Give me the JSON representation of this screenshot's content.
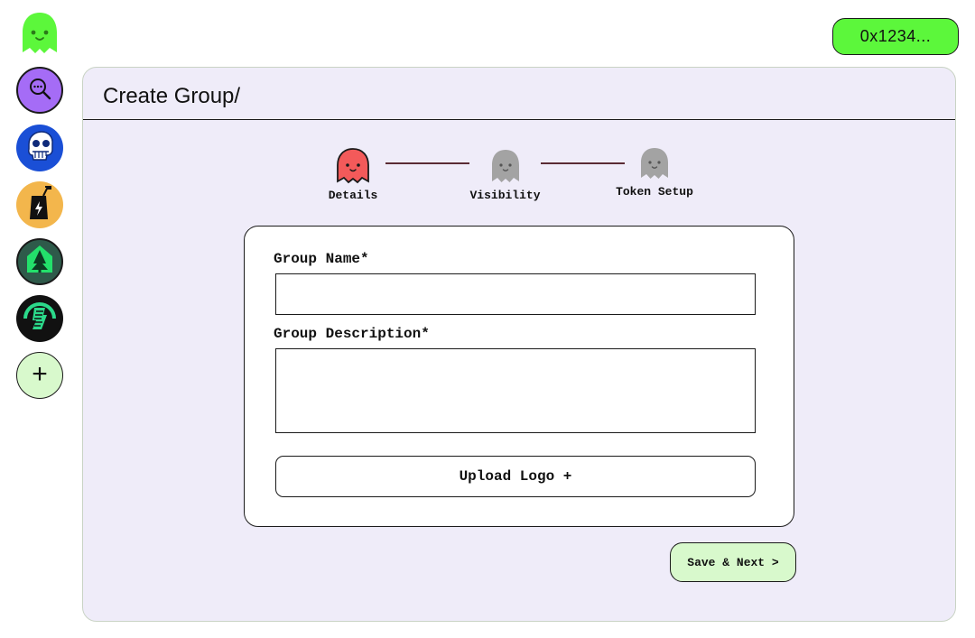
{
  "app": {
    "logo_icon": "ghost-logo-icon",
    "brand_color": "#5cf73b"
  },
  "sidebar": {
    "items": [
      {
        "name": "search-groups",
        "icon": "search-chat-icon",
        "color": "#a56cf6"
      },
      {
        "name": "ape-group",
        "icon": "ape-skull-icon",
        "color": "#1a4fd6"
      },
      {
        "name": "juice-group",
        "icon": "juice-box-icon",
        "color": "#f3b64c"
      },
      {
        "name": "tree-group",
        "icon": "tree-house-icon",
        "color": "#2e5a4a"
      },
      {
        "name": "bolt-group",
        "icon": "bolt-arc-icon",
        "color": "#111111"
      },
      {
        "name": "add-group",
        "icon": "plus-icon",
        "label": "+"
      }
    ]
  },
  "wallet": {
    "address": "0x1234..."
  },
  "page": {
    "title": "Create Group/"
  },
  "stepper": {
    "steps": [
      {
        "label": "Details",
        "status": "active",
        "color": "#f35a5a"
      },
      {
        "label": "Visibility",
        "status": "pending",
        "color": "#a3a3a3"
      },
      {
        "label": "Token Setup",
        "status": "pending",
        "color": "#a3a3a3"
      }
    ],
    "connector_color": "#5a2b34"
  },
  "form": {
    "group_name_label": "Group Name*",
    "group_name_value": "",
    "group_description_label": "Group Description*",
    "group_description_value": "",
    "upload_logo_label": "Upload Logo +"
  },
  "actions": {
    "save_next_label": "Save & Next >"
  }
}
